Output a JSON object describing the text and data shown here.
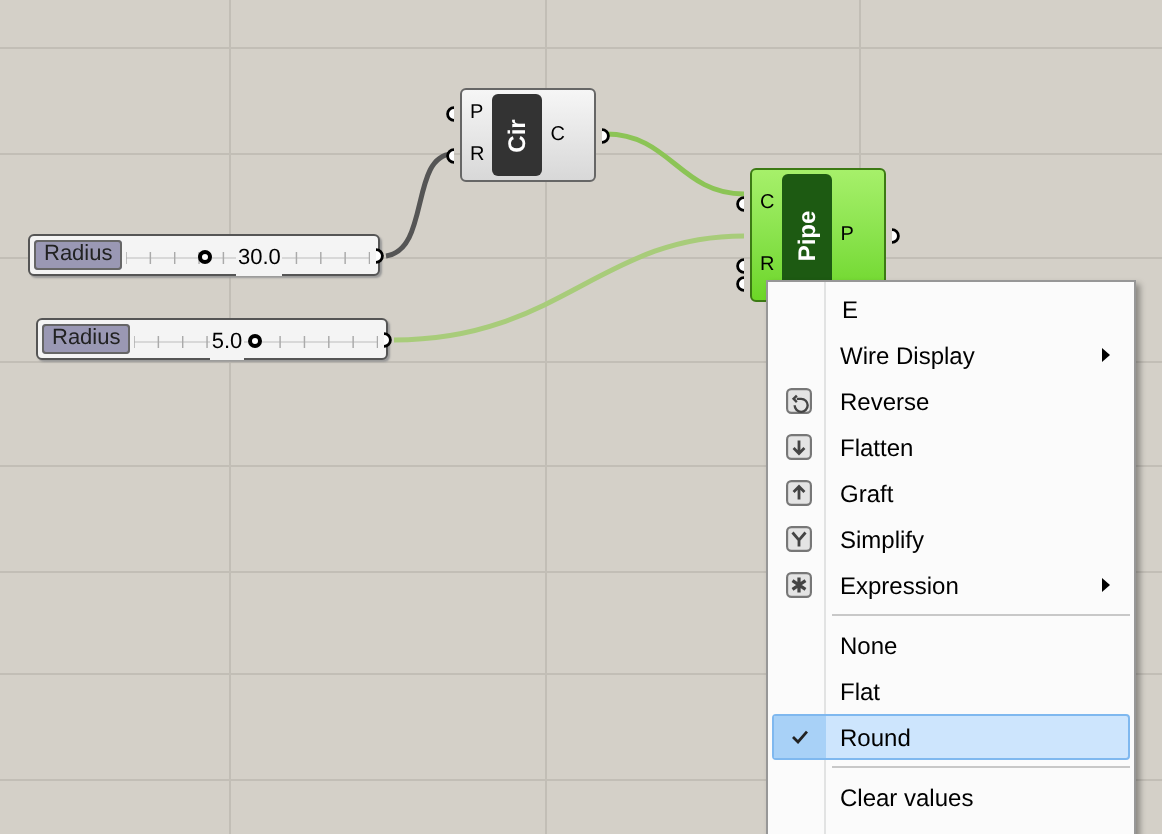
{
  "canvas": {
    "sliders": [
      {
        "label": "Radius",
        "value": "30.0",
        "level": 0.33
      },
      {
        "label": "Radius",
        "value": "5.0",
        "level": 0.5
      }
    ],
    "components": [
      {
        "title": "Cir",
        "selected": false,
        "inputs": [
          "P",
          "R"
        ],
        "outputs": [
          "C"
        ]
      },
      {
        "title": "Pipe",
        "selected": true,
        "inputs": [
          "C",
          "R"
        ],
        "outputs": [
          "P"
        ]
      }
    ]
  },
  "context_menu": {
    "items": [
      {
        "kind": "label",
        "label": "E"
      },
      {
        "kind": "submenu",
        "label": "Wire Display"
      },
      {
        "kind": "icon",
        "label": "Reverse"
      },
      {
        "kind": "icon",
        "label": "Flatten"
      },
      {
        "kind": "icon",
        "label": "Graft"
      },
      {
        "kind": "icon",
        "label": "Simplify"
      },
      {
        "kind": "icon-submenu",
        "label": "Expression"
      },
      {
        "kind": "separator"
      },
      {
        "kind": "option",
        "label": "None",
        "checked": false
      },
      {
        "kind": "option",
        "label": "Flat",
        "checked": false
      },
      {
        "kind": "option",
        "label": "Round",
        "checked": true
      },
      {
        "kind": "separator"
      },
      {
        "kind": "action",
        "label": "Clear values"
      }
    ]
  }
}
